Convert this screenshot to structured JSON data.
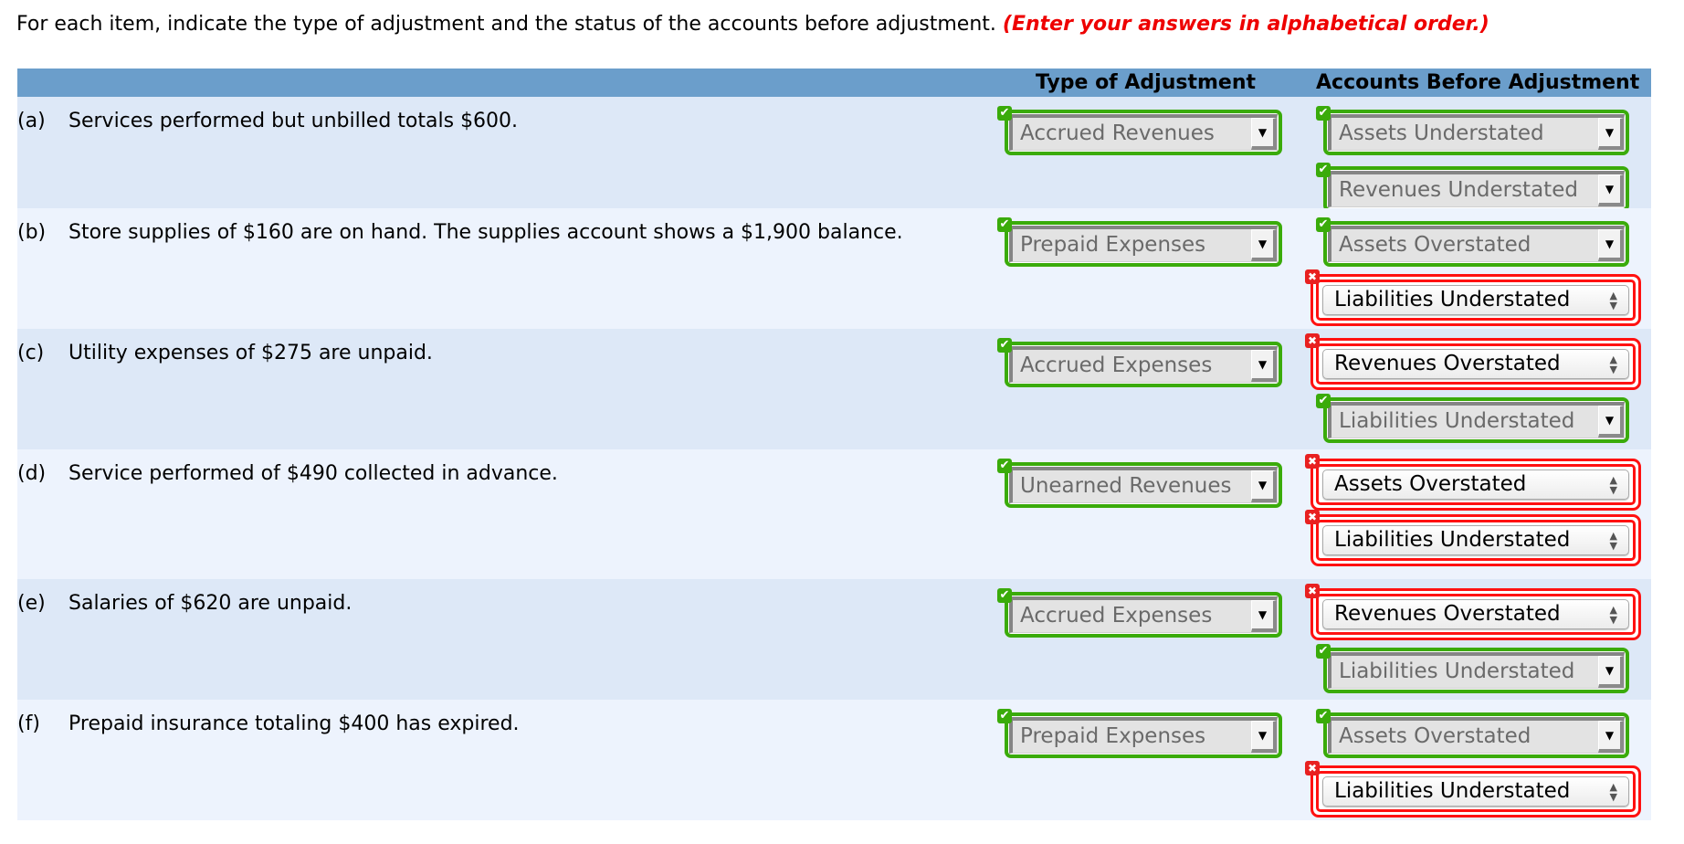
{
  "instructions": {
    "text": "For each item, indicate the type of adjustment and the status of the accounts before adjustment.",
    "emphasis": "(Enter your answers in alphabetical order.)"
  },
  "colors": {
    "header_band": "#6b9ecb",
    "row_odd": "#dde8f7",
    "row_even": "#edf3fd",
    "correct": "#3aab0a",
    "incorrect": "#ff1111",
    "emphasis": "#ee0000"
  },
  "table": {
    "headers": {
      "type": "Type of Adjustment",
      "accounts": "Accounts Before Adjustment"
    },
    "rows": [
      {
        "letter": "(a)",
        "description": "Services performed but unbilled totals $600.",
        "type": {
          "value": "Accrued Revenues",
          "status": "correct"
        },
        "accounts": [
          {
            "value": "Assets Understated",
            "status": "correct"
          },
          {
            "value": "Revenues Understated",
            "status": "correct"
          }
        ]
      },
      {
        "letter": "(b)",
        "description": "Store supplies of $160 are on hand. The supplies account shows a $1,900 balance.",
        "type": {
          "value": "Prepaid Expenses",
          "status": "correct"
        },
        "accounts": [
          {
            "value": "Assets Overstated",
            "status": "correct"
          },
          {
            "value": "Liabilities Understated",
            "status": "incorrect"
          }
        ]
      },
      {
        "letter": "(c)",
        "description": "Utility expenses of $275 are unpaid.",
        "type": {
          "value": "Accrued Expenses",
          "status": "correct"
        },
        "accounts": [
          {
            "value": "Revenues Overstated",
            "status": "incorrect"
          },
          {
            "value": "Liabilities Understated",
            "status": "correct"
          }
        ]
      },
      {
        "letter": "(d)",
        "description": "Service performed of $490 collected in advance.",
        "type": {
          "value": "Unearned Revenues",
          "status": "correct"
        },
        "accounts": [
          {
            "value": "Assets Overstated",
            "status": "incorrect"
          },
          {
            "value": "Liabilities Understated",
            "status": "incorrect"
          }
        ]
      },
      {
        "letter": "(e)",
        "description": "Salaries of $620 are unpaid.",
        "type": {
          "value": "Accrued Expenses",
          "status": "correct"
        },
        "accounts": [
          {
            "value": "Revenues Overstated",
            "status": "incorrect"
          },
          {
            "value": "Liabilities Understated",
            "status": "correct"
          }
        ]
      },
      {
        "letter": "(f)",
        "description": "Prepaid insurance totaling $400 has expired.",
        "type": {
          "value": "Prepaid Expenses",
          "status": "correct"
        },
        "accounts": [
          {
            "value": "Assets Overstated",
            "status": "correct"
          },
          {
            "value": "Liabilities Understated",
            "status": "incorrect"
          }
        ]
      }
    ]
  },
  "icons": {
    "correct": "check-icon",
    "incorrect": "x-icon",
    "dropdown": "triangle-down",
    "updown": "up-down-arrows"
  }
}
